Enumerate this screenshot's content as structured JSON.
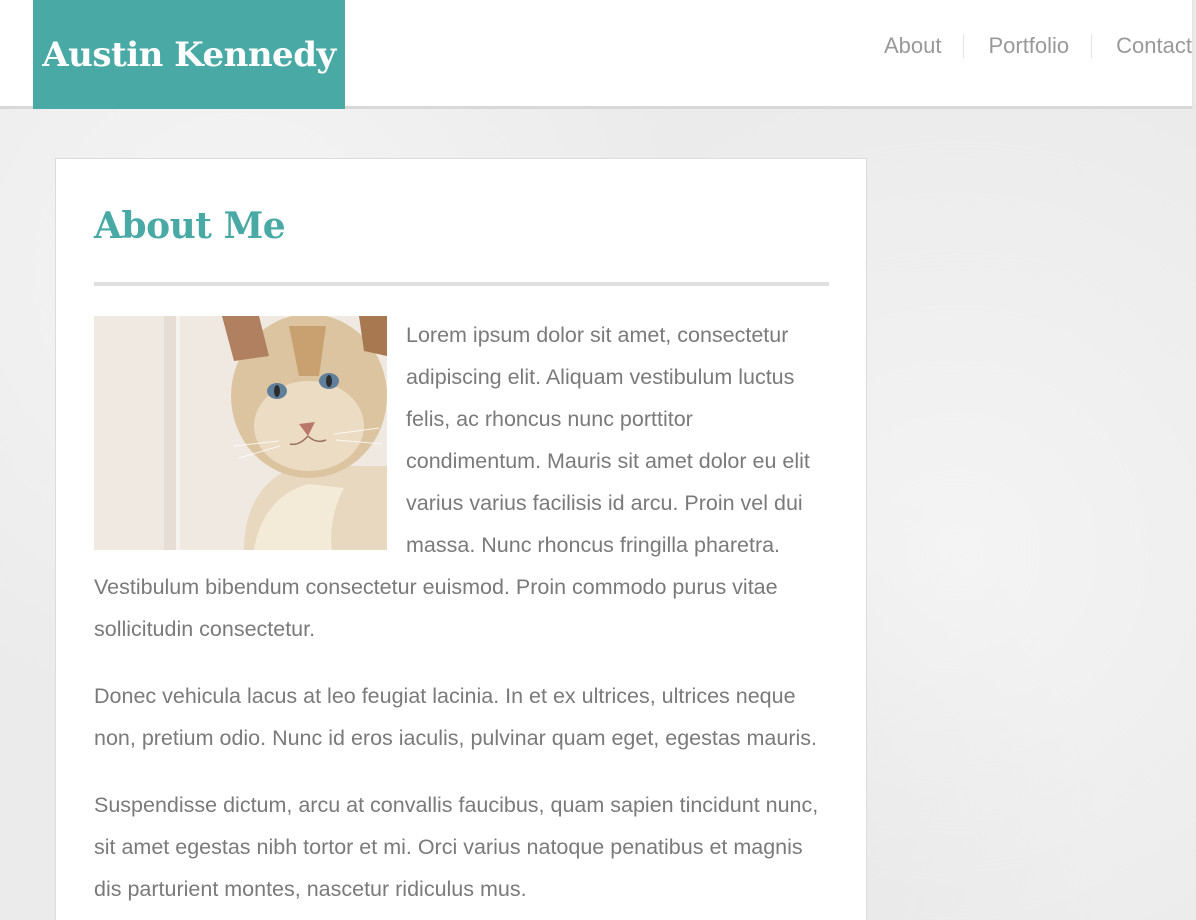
{
  "header": {
    "logo": "Austin Kennedy",
    "nav": [
      "About",
      "Portfolio",
      "Contact"
    ]
  },
  "main": {
    "title": "About Me",
    "image_subject": "cat-photo",
    "paragraphs": [
      "Lorem ipsum dolor sit amet, consectetur adipiscing elit. Aliquam vestibulum luctus felis, ac rhoncus nunc porttitor condimentum. Mauris sit amet dolor eu elit varius varius facilisis id arcu. Proin vel dui massa. Nunc rhoncus fringilla pharetra. Vestibulum bibendum consectetur euismod. Proin commodo purus vitae sollicitudin consectetur.",
      "Donec vehicula lacus at leo feugiat lacinia. In et ex ultrices, ultrices neque non, pretium odio. Nunc id eros iaculis, pulvinar quam eget, egestas mauris.",
      "Suspendisse dictum, arcu at convallis faucibus, quam sapien tincidunt nunc, sit amet egestas nibh tortor et mi. Orci varius natoque penatibus et magnis dis parturient montes, nascetur ridiculus mus."
    ]
  },
  "colors": {
    "accent": "#49aaa5",
    "text": "#7a7a7a",
    "nav_text": "#999999",
    "background": "#ebebeb"
  }
}
